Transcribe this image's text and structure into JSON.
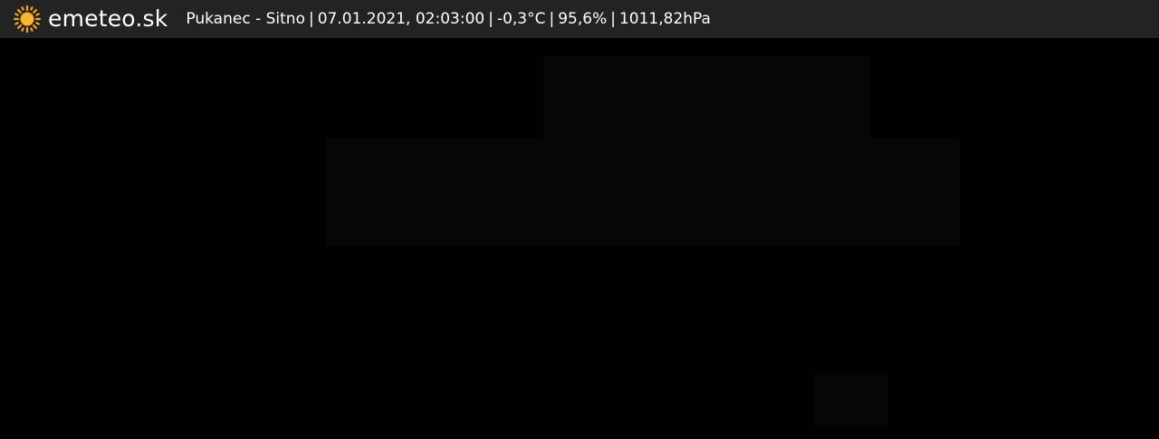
{
  "brand": {
    "logo_icon": "sun-icon",
    "name": "emeteo.sk",
    "accent_color": "#f5a623"
  },
  "overlay": {
    "location": "Pukanec - Sitno",
    "datetime": "07.01.2021, 02:03:00",
    "temperature": "-0,3°C",
    "humidity": "95,6%",
    "pressure": "1011,82hPa",
    "separator": "|"
  },
  "colors": {
    "bar_background": "#232323",
    "image_background": "#000000",
    "text": "#ffffff"
  }
}
